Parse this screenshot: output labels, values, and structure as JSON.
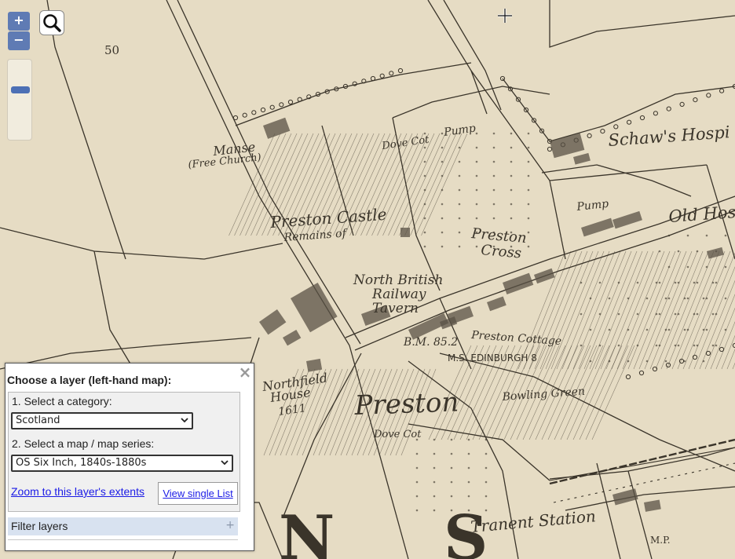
{
  "controls": {
    "zoom_in_label": "+",
    "zoom_out_label": "−",
    "zoom_level_fraction": 0.35
  },
  "map": {
    "colors": {
      "paper": "#e6dcc4",
      "ink": "#3a342a"
    },
    "labels": [
      {
        "id": "num-50",
        "text": "50"
      },
      {
        "id": "manse",
        "text": "Manse"
      },
      {
        "id": "free-church",
        "text": "(Free Church)"
      },
      {
        "id": "dovecot-top",
        "text": "Dove Cot"
      },
      {
        "id": "pump-1",
        "text": "Pump"
      },
      {
        "id": "schaws",
        "text": "Schaw's Hospi"
      },
      {
        "id": "pump-2",
        "text": "Pump"
      },
      {
        "id": "old-hos",
        "text": "Old Hos"
      },
      {
        "id": "preston-castle",
        "text": "Preston Castle"
      },
      {
        "id": "remains",
        "text": "Remains of"
      },
      {
        "id": "preston-cross-1",
        "text": "Preston"
      },
      {
        "id": "preston-cross-2",
        "text": "Cross"
      },
      {
        "id": "nbr-1",
        "text": "North British"
      },
      {
        "id": "nbr-2",
        "text": "Railway"
      },
      {
        "id": "nbr-3",
        "text": "Tavern"
      },
      {
        "id": "preston-cottage",
        "text": "Preston Cottage"
      },
      {
        "id": "bm",
        "text": "B.M. 85.2"
      },
      {
        "id": "ms-edinburgh",
        "text": "M.S. EDINBURGH 8"
      },
      {
        "id": "northfield-1",
        "text": "Northfield"
      },
      {
        "id": "northfield-2",
        "text": "House"
      },
      {
        "id": "northfield-3",
        "text": "1611"
      },
      {
        "id": "preston-big",
        "text": "Preston"
      },
      {
        "id": "bowling-green",
        "text": "Bowling Green"
      },
      {
        "id": "dovecot-bottom",
        "text": "Dove Cot"
      },
      {
        "id": "tranent-station",
        "text": "Tranent Station"
      },
      {
        "id": "mp",
        "text": "M.P."
      },
      {
        "id": "big-n",
        "text": "N"
      },
      {
        "id": "big-s",
        "text": "S"
      }
    ]
  },
  "panel": {
    "title": "Choose a layer (left-hand map):",
    "close_label": "×",
    "step1_label": "1. Select a category:",
    "category_value": "Scotland",
    "step2_label": "2. Select a map / map series:",
    "series_value": "OS Six Inch, 1840s-1880s",
    "zoom_link": "Zoom to this layer's extents",
    "single_list": "View single List",
    "filter_label": "Filter layers",
    "filter_plus": "+"
  }
}
